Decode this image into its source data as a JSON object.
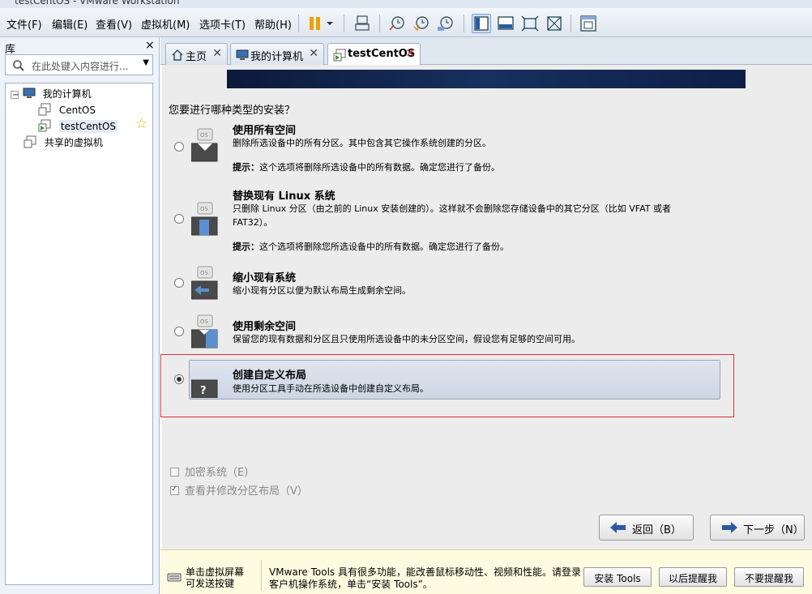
{
  "window": {
    "title": "testCentOS - VMware Workstation"
  },
  "menu": [
    {
      "label": "文件(F)"
    },
    {
      "label": "编辑(E)"
    },
    {
      "label": "查看(V)"
    },
    {
      "label": "虚拟机(M)"
    },
    {
      "label": "选项卡(T)"
    },
    {
      "label": "帮助(H)"
    }
  ],
  "library": {
    "title": "库",
    "close": "×",
    "search_placeholder": "在此处键入内容进行...",
    "tree": {
      "my_computer": "我的计算机",
      "vm1": "CentOS",
      "vm2": "testCentOS",
      "shared": "共享的虚拟机"
    }
  },
  "tabs": [
    {
      "label": "主页",
      "icon": "home-icon"
    },
    {
      "label": "我的计算机",
      "icon": "computer-icon"
    },
    {
      "label": "testCentOS",
      "icon": "vm-icon"
    }
  ],
  "installer": {
    "question": "您要进行哪种类型的安装？",
    "options": [
      {
        "title": "使用所有空间",
        "desc": "删除所选设备中的所有分区。其中包含其它操作系统创建的分区。",
        "tip_label": "提示：",
        "tip": "这个选项将删除所选设备中的所有数据。确定您进行了备份。"
      },
      {
        "title": "替换现有 Linux 系统",
        "desc": "只删除 Linux 分区（由之前的 Linux 安装创建的）。这样就不会删除您存储设备中的其它分区（比如 VFAT 或者 FAT32）。",
        "tip_label": "提示：",
        "tip": "这个选项将删除您所选设备中的所有数据。确定您进行了备份。"
      },
      {
        "title": "缩小现有系统",
        "desc": "缩小现有分区以便为默认布局生成剩余空间。"
      },
      {
        "title": "使用剩余空间",
        "desc": "保留您的现有数据和分区且只使用所选设备中的未分区空间，假设您有足够的空间可用。"
      },
      {
        "title": "创建自定义布局",
        "desc": "使用分区工具手动在所选设备中创建自定义布局。",
        "selected": true
      }
    ],
    "encrypt": "加密系统（E）",
    "review": "查看并修改分区布局（V）",
    "back": "返回（B）",
    "next": "下一步（N）"
  },
  "hint": {
    "left": "单击虚拟屏幕\n可发送按键",
    "message": "VMware Tools 具有很多功能，能改善鼠标移动性、视频和性能。请登录客户机操作系统，单击“安装 Tools”。",
    "install": "安装 Tools",
    "later": "以后提醒我",
    "never": "不要提醒我"
  },
  "colors": {
    "accent": "#1f4f8f",
    "highlight": "#e03030",
    "hint_bg": "#fdfbe0"
  }
}
